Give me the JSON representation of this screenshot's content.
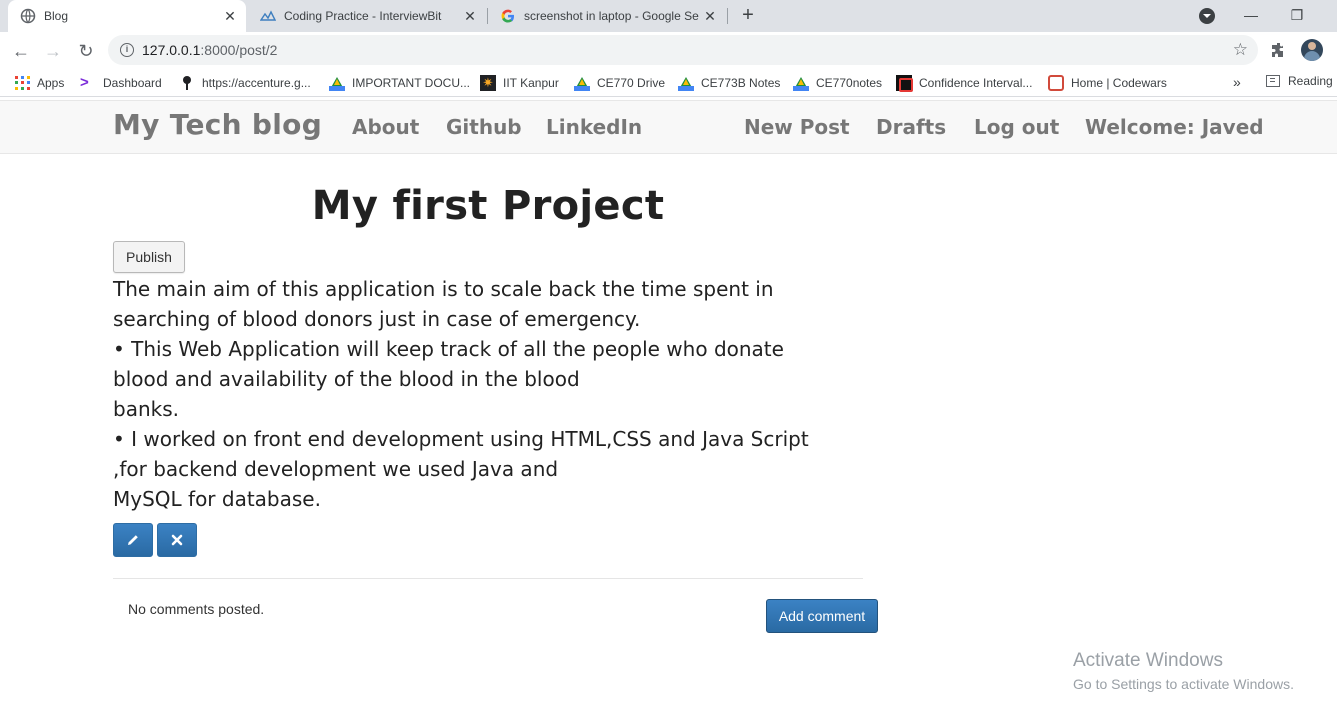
{
  "browser": {
    "tabs": [
      {
        "title": "Blog",
        "active": true,
        "icon": "globe-icon"
      },
      {
        "title": "Coding Practice - InterviewBit",
        "active": false,
        "icon": "interviewbit-icon"
      },
      {
        "title": "screenshot in laptop - Google Se",
        "active": false,
        "icon": "google-icon"
      }
    ],
    "url_host": "127.0.0.1",
    "url_path": ":8000/post/2",
    "bookmarks": [
      {
        "label": "Apps",
        "icon": "apps-grid-icon"
      },
      {
        "label": "Dashboard",
        "icon": "accenture-icon"
      },
      {
        "label": "https://accenture.g...",
        "icon": "pin-icon"
      },
      {
        "label": "IMPORTANT DOCU...",
        "icon": "drive-icon"
      },
      {
        "label": "IIT Kanpur",
        "icon": "iitk-icon"
      },
      {
        "label": "CE770 Drive",
        "icon": "drive-icon"
      },
      {
        "label": "CE773B Notes",
        "icon": "drive-icon"
      },
      {
        "label": "CE770notes",
        "icon": "drive-icon"
      },
      {
        "label": "Confidence Interval...",
        "icon": "confidence-icon"
      },
      {
        "label": "Home | Codewars",
        "icon": "codewars-icon"
      }
    ],
    "more_bookmarks": "»",
    "reading_list": "Reading"
  },
  "site": {
    "brand": "My Tech blog",
    "nav_left": [
      "About",
      "Github",
      "LinkedIn"
    ],
    "nav_right": [
      "New Post",
      "Drafts",
      "Log out",
      "Welcome: Javed"
    ],
    "brand_color": "#777777"
  },
  "post": {
    "title": "My first Project",
    "publish_label": "Publish",
    "body_lines": [
      "The main aim of this application is to scale back the time spent in",
      "searching of blood donors just in case of emergency.",
      "• This Web Application will keep track of all the people who donate",
      "blood and availability of the blood in the blood",
      "banks.",
      "• I worked on front end development using HTML,CSS and Java Script",
      ",for backend development we used Java and",
      "MySQL for database."
    ],
    "edit_icon": "pencil-icon",
    "delete_icon": "remove-icon",
    "no_comments": "No comments posted.",
    "add_comment_label": "Add comment",
    "primary_color": "#337ab7"
  },
  "watermark": {
    "line1": "Activate Windows",
    "line2": "Go to Settings to activate Windows."
  }
}
